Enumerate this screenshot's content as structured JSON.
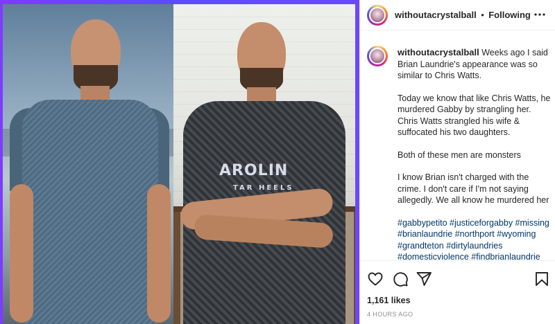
{
  "post": {
    "username": "withoutacrystalball",
    "separator": "•",
    "follow_status": "Following",
    "more_label": "•••"
  },
  "caption": {
    "username": "withoutacrystalball",
    "paragraph1": "Weeks ago I said Brian Laundrie's appearance was so similar to Chris Watts.",
    "paragraph2": "Today we know that like Chris Watts, he murdered Gabby by strangling her. Chris Watts strangled his wife & suffocated his two daughters.",
    "paragraph3": "Both of these men are monsters",
    "paragraph4": "I know Brian isn't charged with the crime. I don't care if I'm not saying allegedly. We all know he murdered her",
    "hashtags": "#gabbypetito #justiceforgabby #missing #brianlaundrie #northport #wyoming #grandteton #dirtylaundries #domesticviolence #findbrianlaundrie"
  },
  "engagement": {
    "likes": "1,161 likes",
    "time": "4 HOURS AGO"
  },
  "image": {
    "shirt_text": "AROLIN",
    "shirt_subtext": "TAR HEELS"
  },
  "icons": {
    "like": "heart-icon",
    "comment": "comment-icon",
    "share": "paper-plane-icon",
    "save": "bookmark-icon",
    "more": "more-dots-icon"
  },
  "colors": {
    "accent_background": "#6a48ff",
    "text": "#262626",
    "hashtag": "#00376b",
    "muted": "#8e8e8e"
  }
}
